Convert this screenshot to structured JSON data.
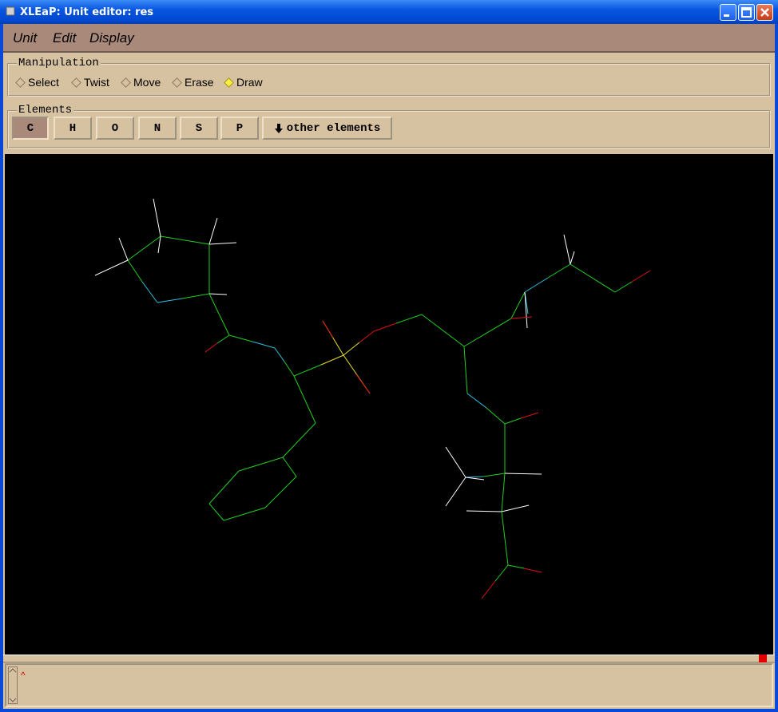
{
  "window": {
    "title": "XLEaP: Unit editor: res"
  },
  "menu": {
    "items": [
      "Unit",
      "Edit",
      "Display"
    ]
  },
  "manipulation": {
    "label": "Manipulation",
    "options": [
      "Select",
      "Twist",
      "Move",
      "Erase",
      "Draw"
    ],
    "selected": "Draw"
  },
  "elements": {
    "label": "Elements",
    "buttons": [
      "C",
      "H",
      "O",
      "N",
      "S",
      "P"
    ],
    "selected": "C",
    "other_label": "other elements"
  },
  "colors": {
    "carbon": "#20d020",
    "nitrogen": "#30c0e0",
    "oxygen": "#e01010",
    "hydrogen": "#ffffff",
    "phosphorus": "#e8e020",
    "canvas_bg": "#000000",
    "panel_bg": "#d6c2a0",
    "menubar_bg": "#a8897a"
  },
  "console": {
    "text": ""
  }
}
